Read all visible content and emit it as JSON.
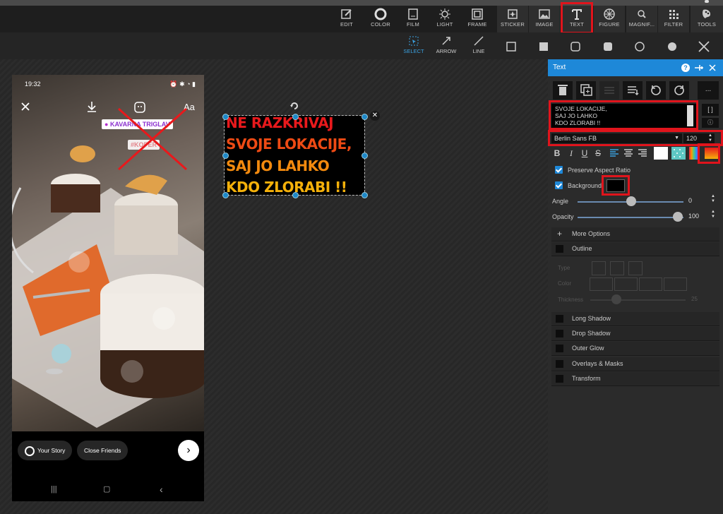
{
  "toolbar": {
    "items": [
      {
        "label": "EDIT",
        "icon": "edit-icon"
      },
      {
        "label": "COLOR",
        "icon": "color-icon"
      },
      {
        "label": "FILM",
        "icon": "film-icon"
      },
      {
        "label": "LIGHT",
        "icon": "light-icon"
      },
      {
        "label": "FRAME",
        "icon": "frame-icon"
      },
      {
        "label": "STICKER",
        "icon": "sticker-icon"
      },
      {
        "label": "IMAGE",
        "icon": "image-icon"
      },
      {
        "label": "TEXT",
        "icon": "text-icon"
      },
      {
        "label": "FIGURE",
        "icon": "figure-icon"
      },
      {
        "label": "MAGNIF...",
        "icon": "magnifier-icon"
      },
      {
        "label": "FILTER",
        "icon": "filter-icon"
      },
      {
        "label": "TOOLS",
        "icon": "tools-icon"
      }
    ]
  },
  "subbar": {
    "select": "SELECT",
    "arrow": "ARROW",
    "line": "LINE"
  },
  "phone": {
    "time": "19:32",
    "location_tag": "KAVARNA TRIGLAV",
    "hashtag": "#KOPER",
    "aa": "Aa",
    "your_story": "Your Story",
    "close_friends": "Close Friends"
  },
  "canvas_text": {
    "lines": [
      "NE RAZKRIVAJ",
      "SVOJE LOKACIJE,",
      "SAJ JO LAHKO",
      "KDO ZLORABI !!"
    ],
    "colors": [
      "#e8191c",
      "#ee4a14",
      "#f38a0e",
      "#f5b10a"
    ]
  },
  "panel": {
    "title": "Text",
    "textarea": "SVOJE LOKACIJE,\nSAJ JO LAHKO\nKDO ZLORABI !!",
    "bracket_btn": "[ ]",
    "more_btn": "...",
    "font": "Berlin Sans FB",
    "size": "120",
    "preserve_aspect": "Preserve Aspect Ratio",
    "background": "Background",
    "angle_label": "Angle",
    "angle_value": "0",
    "opacity_label": "Opacity",
    "opacity_value": "100",
    "more_options": "More Options",
    "outline": "Outline",
    "type": "Type",
    "color": "Color",
    "thickness": "Thickness",
    "thickness_value": "25",
    "long_shadow": "Long Shadow",
    "drop_shadow": "Drop Shadow",
    "outer_glow": "Outer Glow",
    "overlays_masks": "Overlays & Masks",
    "transform": "Transform",
    "accent": "#1e88d8",
    "highlight": "#e0141c"
  }
}
